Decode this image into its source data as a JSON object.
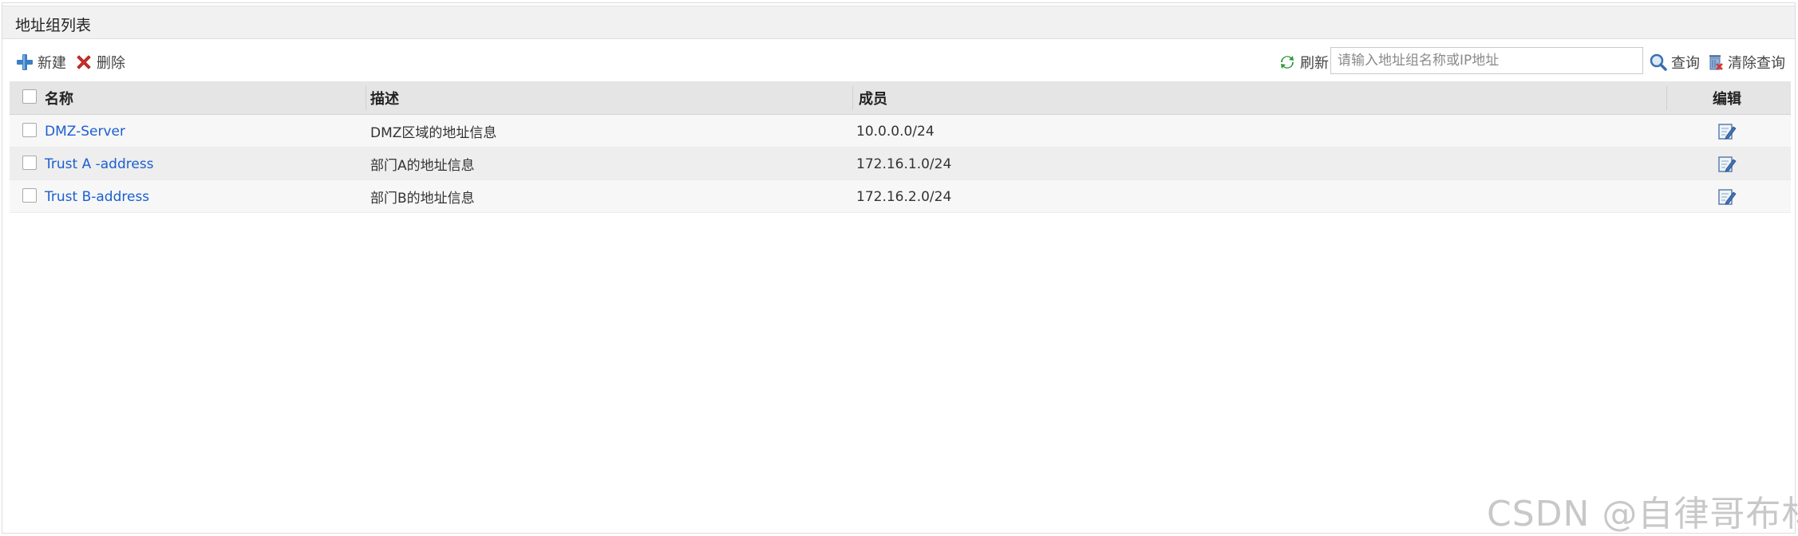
{
  "panel": {
    "title": "地址组列表"
  },
  "toolbar": {
    "new_label": "新建",
    "delete_label": "删除",
    "refresh_label": "刷新",
    "search_placeholder": "请输入地址组名称或IP地址",
    "search_value": "",
    "query_label": "查询",
    "clear_label": "清除查询",
    "icons": {
      "new": "plus-icon",
      "delete": "red-x-icon",
      "refresh": "refresh-icon",
      "query": "magnifier-icon",
      "clear": "trash-icon"
    }
  },
  "table": {
    "columns": [
      "名称",
      "描述",
      "成员",
      "编辑"
    ],
    "rows": [
      {
        "name": "DMZ-Server",
        "desc": "DMZ区域的地址信息",
        "member": "10.0.0.0/24"
      },
      {
        "name": "Trust A -address",
        "desc": "部门A的地址信息",
        "member": "172.16.1.0/24"
      },
      {
        "name": "Trust B-address",
        "desc": "部门B的地址信息",
        "member": "172.16.2.0/24"
      }
    ],
    "edit_icon": "edit-icon"
  },
  "watermark": "CSDN @自律哥布林",
  "colors": {
    "link": "#1a5fcf",
    "header_bg": "#e5e5e5",
    "row_odd": "#f7f7f7",
    "row_even": "#eeeeee"
  }
}
